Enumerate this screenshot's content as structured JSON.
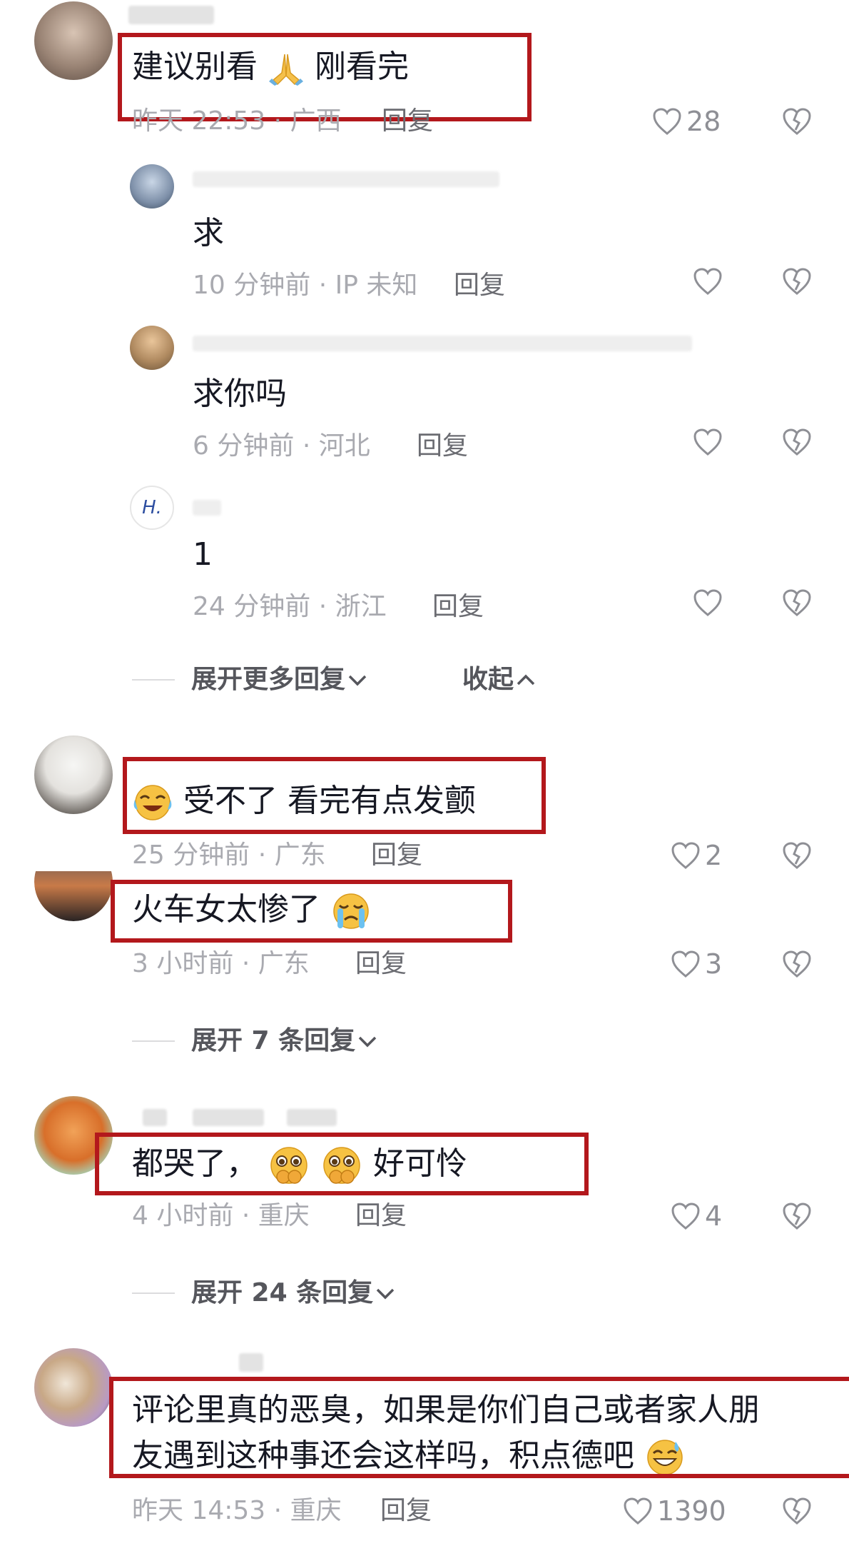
{
  "comments": [
    {
      "text": "建议别看",
      "text_after": "刚看完",
      "emoji_mid": "pray-emoji",
      "time": "昨天 22:53",
      "location": "广西",
      "reply_label": "回复",
      "likes": "28",
      "replies": [
        {
          "text": "求",
          "time": "10 分钟前",
          "location": "IP 未知",
          "reply_label": "回复"
        },
        {
          "text": "求你吗",
          "time": "6 分钟前",
          "location": "河北",
          "reply_label": "回复"
        },
        {
          "text": "1",
          "time": "24 分钟前",
          "location": "浙江",
          "reply_label": "回复",
          "avatar_text": "H."
        }
      ],
      "expand_label": "展开更多回复",
      "collapse_label": "收起"
    },
    {
      "emoji_lead": "laugh-cry-emoji",
      "text": "受不了  看完有点发颤",
      "time": "25 分钟前",
      "location": "广东",
      "reply_label": "回复",
      "likes": "2"
    },
    {
      "text": "火车女太惨了",
      "emoji_end": "crying-emoji",
      "time": "3 小时前",
      "location": "广东",
      "reply_label": "回复",
      "likes": "3",
      "expand_label": "展开 7 条回复"
    },
    {
      "text": "都哭了，",
      "emoji_mid": "pleading-emoji",
      "text_after": "好可怜",
      "time": "4 小时前",
      "location": "重庆",
      "reply_label": "回复",
      "likes": "4",
      "expand_label": "展开 24 条回复"
    },
    {
      "text_line1": "评论里真的恶臭，如果是你们自己或者家人朋",
      "text_line2": "友遇到这种事还会这样吗，积点德吧",
      "emoji_end": "sweat-smile-emoji",
      "time": "昨天 14:53",
      "location": "重庆",
      "reply_label": "回复",
      "likes": "1390"
    }
  ],
  "separator": "·",
  "colors": {
    "highlight": "#b3181c",
    "meta": "#a9aab0",
    "text": "#161823"
  }
}
